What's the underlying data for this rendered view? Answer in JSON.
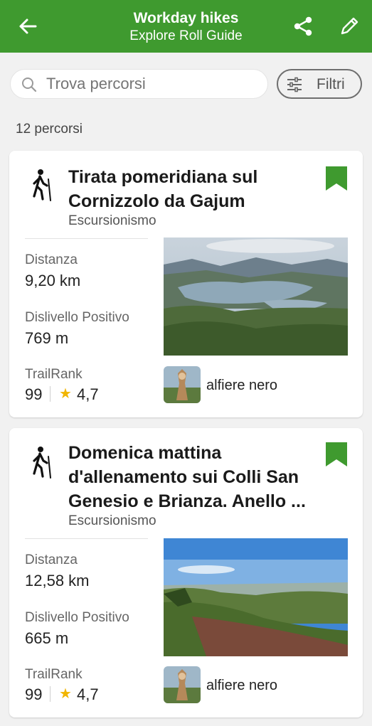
{
  "header": {
    "title": "Workday hikes",
    "subtitle": "Explore Roll Guide",
    "icons": {
      "back": "arrow-left-icon",
      "share": "share-icon",
      "edit": "pencil-icon"
    },
    "color": "#3f9a2f"
  },
  "search": {
    "placeholder": "Trova percorsi"
  },
  "filter": {
    "label": "Filtri"
  },
  "results_count": "12 percorsi",
  "trails": [
    {
      "title_line1": "Tirata pomeridiana sul",
      "title_line2": "Cornizzolo da Gajum",
      "sport": "Escursionismo",
      "distance_label": "Distanza",
      "distance": "9,20 km",
      "elevation_label": "Dislivello Positivo",
      "elevation": "769 m",
      "trailrank_label": "TrailRank",
      "trailrank": "99",
      "rating": "4,7",
      "author": "alfiere nero",
      "bookmarked": true
    },
    {
      "title_line1": "Domenica mattina",
      "title_line2": "d'allenamento sui Colli San",
      "title_line3": "Genesio e Brianza. Anello ...",
      "sport": "Escursionismo",
      "distance_label": "Distanza",
      "distance": "12,58 km",
      "elevation_label": "Dislivello Positivo",
      "elevation": "665 m",
      "trailrank_label": "TrailRank",
      "trailrank": "99",
      "rating": "4,7",
      "author": "alfiere nero",
      "bookmarked": true
    }
  ]
}
